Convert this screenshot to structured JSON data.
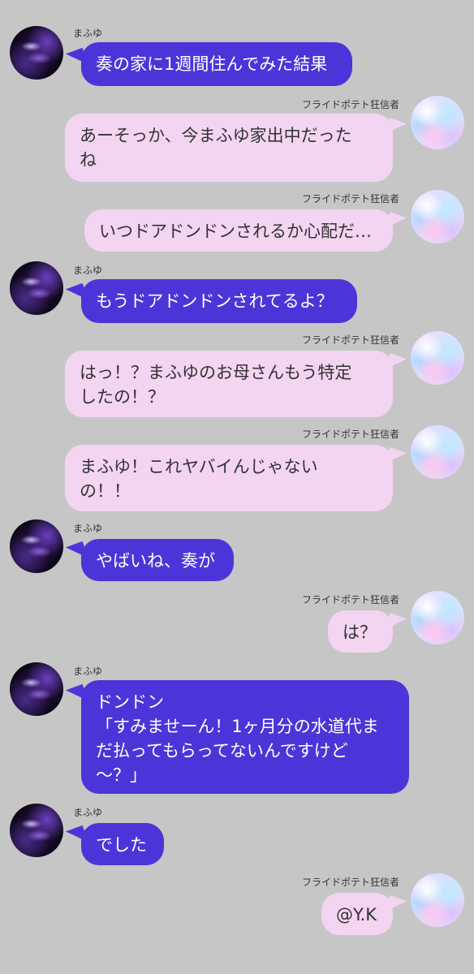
{
  "participants": {
    "left_name": "まふゆ",
    "right_name": "フライドポテト狂信者"
  },
  "messages": [
    {
      "side": "left",
      "sender": "まふゆ",
      "text": "奏の家に1週間住んでみた結果"
    },
    {
      "side": "right",
      "sender": "フライドポテト狂信者",
      "text": "あーそっか、今まふゆ家出中だった\nね"
    },
    {
      "side": "right",
      "sender": "フライドポテト狂信者",
      "text": "いつドアドンドンされるか心配だ…"
    },
    {
      "side": "left",
      "sender": "まふゆ",
      "text": "もうドアドンドンされてるよ？"
    },
    {
      "side": "right",
      "sender": "フライドポテト狂信者",
      "text": "はっ！？まふゆのお母さんもう特定\nしたの！？"
    },
    {
      "side": "right",
      "sender": "フライドポテト狂信者",
      "text": "まふゆ！これヤバイんじゃない\nの！！"
    },
    {
      "side": "left",
      "sender": "まふゆ",
      "text": "やばいね、奏が"
    },
    {
      "side": "right",
      "sender": "フライドポテト狂信者",
      "text": "は？"
    },
    {
      "side": "left",
      "sender": "まふゆ",
      "text": "ドンドン\n「すみませーん！1ヶ月分の水道代ま\nだ払ってもらってないんですけど\n～？」"
    },
    {
      "side": "left",
      "sender": "まふゆ",
      "text": "でした"
    },
    {
      "side": "right",
      "sender": "フライドポテト狂信者",
      "text": "@Y.K"
    }
  ],
  "colors": {
    "background": "#c6c6c6",
    "left_bubble": "#4c35d8",
    "right_bubble": "#f3d4f1"
  }
}
